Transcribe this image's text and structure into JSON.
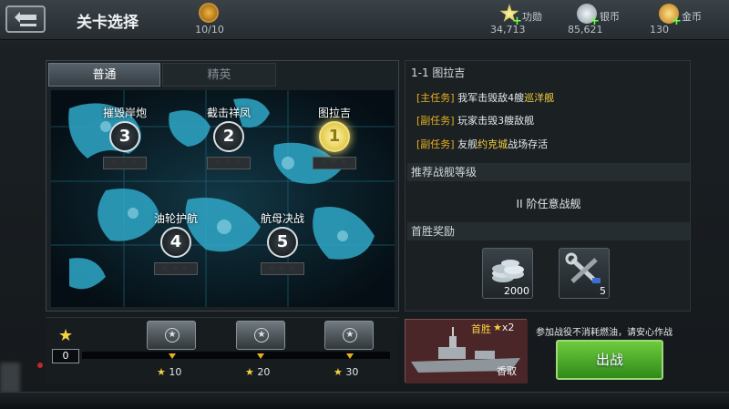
{
  "header": {
    "title": "关卡选择",
    "fuel": "10/10",
    "merit": {
      "label": "功勋",
      "value": "34,713"
    },
    "silver": {
      "label": "银币",
      "value": "85,621"
    },
    "gold": {
      "label": "金币",
      "value": "130"
    }
  },
  "tabs": {
    "normal": "普通",
    "elite": "精英"
  },
  "stages": [
    {
      "name": "摧毁岸炮",
      "number": "3"
    },
    {
      "name": "截击祥凤",
      "number": "2"
    },
    {
      "name": "图拉吉",
      "number": "1"
    },
    {
      "name": "油轮护航",
      "number": "4"
    },
    {
      "name": "航母决战",
      "number": "5"
    }
  ],
  "stage_stars": "★★★",
  "detail": {
    "stage_title": "1-1  图拉吉",
    "tasks": [
      {
        "tag": "[主任务]",
        "pre": "我军击毁敌4艘",
        "hl": "巡洋舰",
        "post": ""
      },
      {
        "tag": "[副任务]",
        "pre": "玩家击毁3艘敌舰",
        "hl": "",
        "post": ""
      },
      {
        "tag": "[副任务]",
        "pre": "友舰",
        "hl": "约克城",
        "post": "战场存活"
      }
    ],
    "recommend_head": "推荐战舰等级",
    "recommend_value": "II 阶任意战舰",
    "reward_head": "首胜奖励",
    "rewards": [
      {
        "icon": "silver-coins-icon",
        "count": "2000"
      },
      {
        "icon": "repair-tools-icon",
        "count": "5"
      }
    ]
  },
  "progress": {
    "star_count": "0",
    "fill_fraction": 0.0,
    "milestones": [
      "10",
      "20",
      "30"
    ]
  },
  "first_win": {
    "label": "首胜",
    "multiplier": "x2",
    "ship": "香取"
  },
  "notice": "参加战役不消耗燃油，请安心作战",
  "fight_label": "出战"
}
